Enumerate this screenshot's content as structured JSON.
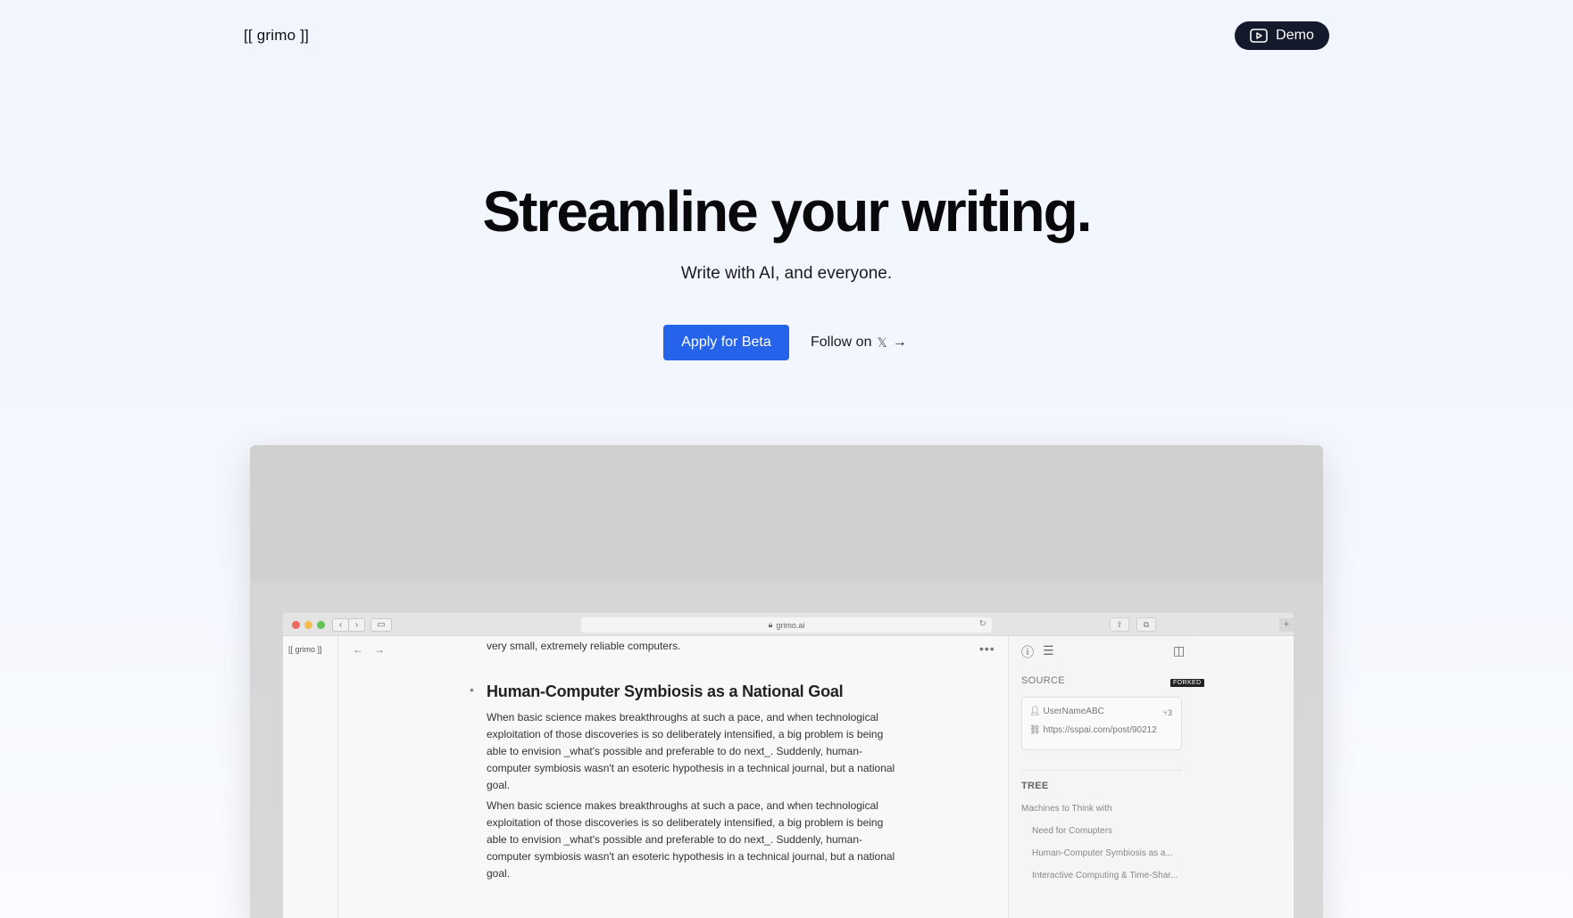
{
  "header": {
    "logo": "[[ grimo ]]",
    "demo_label": "Demo"
  },
  "hero": {
    "title": "Streamline your writing.",
    "subtitle": "Write with AI, and everyone.",
    "primary_cta": "Apply for Beta",
    "secondary_cta": "Follow on",
    "secondary_icon": "𝕏",
    "secondary_arrow": "→"
  },
  "showcase": {
    "url": "grimo.ai",
    "mini_logo": "[[ grimo ]]",
    "doc": {
      "top_line": "very small, extremely reliable computers.",
      "heading": "Human-Computer Symbiosis as a National Goal",
      "paragraphs": [
        "When basic science makes breakthroughs at such a pace, and when technological exploitation of those discoveries is so deliberately intensified, a big problem is being able to envision _what's possible and preferable to do next_. Suddenly, human-computer symbiosis wasn't an esoteric hypothesis in a technical journal, but a national goal.",
        "When basic science makes breakthroughs at such a pace, and when technological exploitation of those discoveries is so deliberately intensified, a big problem is being able to envision _what's possible and preferable to do next_. Suddenly, human-computer symbiosis wasn't an esoteric hypothesis in a technical journal, but a national goal."
      ]
    },
    "sidebar": {
      "source_label": "SOURCE",
      "forked_badge": "FORKED",
      "username": "UserNameABC",
      "fork_count": "3",
      "source_url": "https://sspai.com/post/90212",
      "tree_label": "TREE",
      "tree": [
        "Machines to Think with",
        "Need for Comupters",
        "Human-Computer Symbiosis as a...",
        "Interactive Computing & Time-Shar..."
      ]
    }
  },
  "colors": {
    "primary": "#2563eb",
    "demo_bg": "#141a2b",
    "page_bg": "#f2f6fe"
  },
  "icons": {
    "demo": "play-square-icon",
    "follow_arrow": "arrow-right-icon",
    "x_logo": "x-logo-icon"
  }
}
